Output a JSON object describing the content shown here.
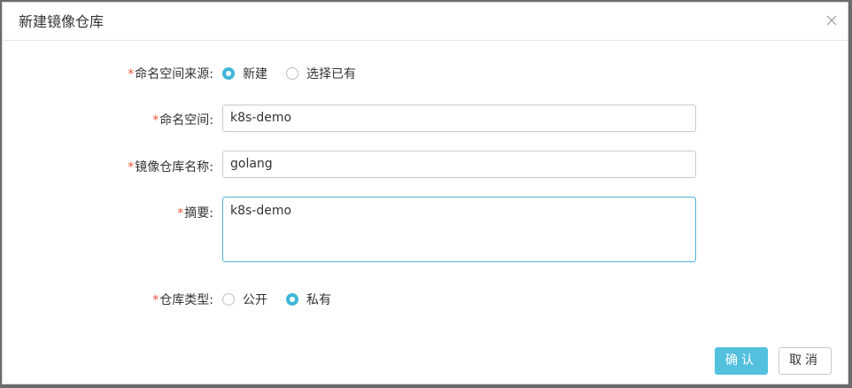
{
  "dialog": {
    "title": "新建镜像仓库",
    "close_icon": "close-icon"
  },
  "form": {
    "required_mark": "*",
    "namespace_source": {
      "label": "命名空间来源:",
      "options": [
        {
          "label": "新建",
          "checked": true
        },
        {
          "label": "选择已有",
          "checked": false
        }
      ]
    },
    "namespace": {
      "label": "命名空间:",
      "value": "k8s-demo"
    },
    "repo_name": {
      "label": "镜像仓库名称:",
      "value": "golang"
    },
    "summary": {
      "label": "摘要:",
      "value": "k8s-demo"
    },
    "repo_type": {
      "label": "仓库类型:",
      "options": [
        {
          "label": "公开",
          "checked": false
        },
        {
          "label": "私有",
          "checked": true
        }
      ]
    }
  },
  "footer": {
    "confirm_label": "确认",
    "cancel_label": "取消"
  },
  "colors": {
    "accent": "#3fb6d8",
    "primary_button": "#53c1de",
    "required": "#e9553b"
  }
}
